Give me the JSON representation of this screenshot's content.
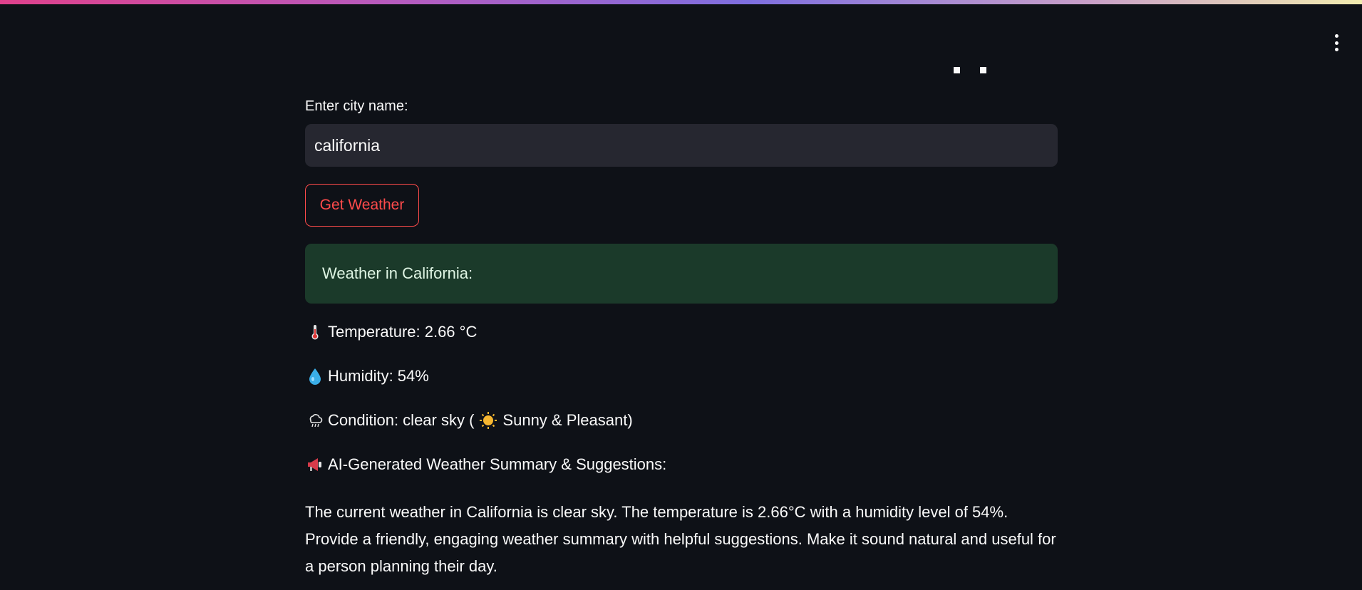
{
  "header": {
    "menu_icon": "kebab-menu-icon",
    "accent_gradient": [
      "#e0418c",
      "#b55cc0",
      "#7e6fe0",
      "#f2ecb0"
    ]
  },
  "form": {
    "label": "Enter city name:",
    "city_value": "california",
    "button_label": "Get Weather"
  },
  "result": {
    "heading": "Weather in California:",
    "temperature": "Temperature: 2.66 °C",
    "humidity": "Humidity: 54%",
    "condition_prefix": "Condition: clear sky (",
    "condition_suffix": "Sunny & Pleasant)",
    "summary_heading": "AI-Generated Weather Summary & Suggestions:",
    "summary_text": "The current weather in California is clear sky. The temperature is 2.66°C with a humidity level of 54%. Provide a friendly, engaging weather summary with helpful suggestions. Make it sound natural and useful for a person planning their day."
  },
  "icons": {
    "temperature": "thermometer-icon",
    "humidity": "droplet-icon",
    "condition": "cloud-rain-icon",
    "sun": "sun-icon",
    "summary": "megaphone-icon"
  },
  "colors": {
    "background": "#0e1117",
    "input_bg": "#262730",
    "button_accent": "#ff4b4b",
    "success_bg": "#1b3a2a"
  }
}
